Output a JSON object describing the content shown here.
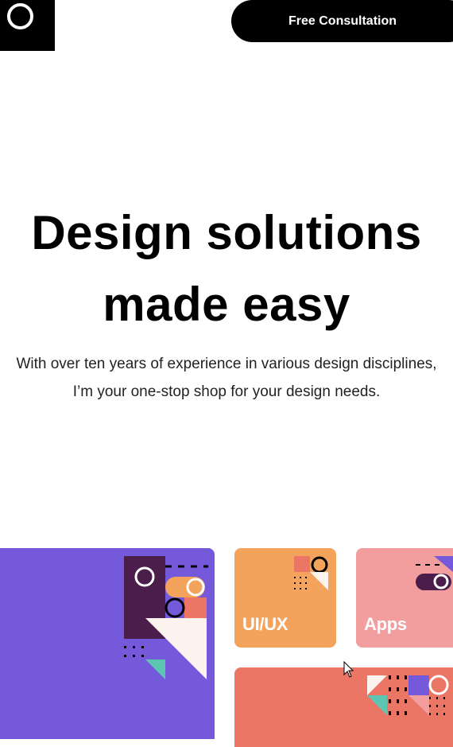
{
  "header": {
    "logo_icon": "ring-logo-icon",
    "cta_label": "Free Consultation"
  },
  "hero": {
    "title_line1": "Design solutions",
    "title_line2": "made easy",
    "subtitle_line1": "With over ten years of experience in various design disciplines,",
    "subtitle_line2": "I’m your one-stop shop for your design needs."
  },
  "services": {
    "cards": [
      {
        "label": "",
        "color": "#7459db"
      },
      {
        "label": "UI/UX",
        "color": "#f4a35d"
      },
      {
        "label": "Apps",
        "color": "#f29e9e"
      },
      {
        "label": "",
        "color": "#ec7665"
      }
    ]
  },
  "colors": {
    "black": "#000000",
    "purple": "#7459db",
    "dark_plum": "#4a1d4a",
    "orange": "#f4a35d",
    "coral": "#ec7665",
    "pink": "#f29e9e",
    "cream": "#fdf3ee",
    "teal": "#5cc6b2"
  }
}
